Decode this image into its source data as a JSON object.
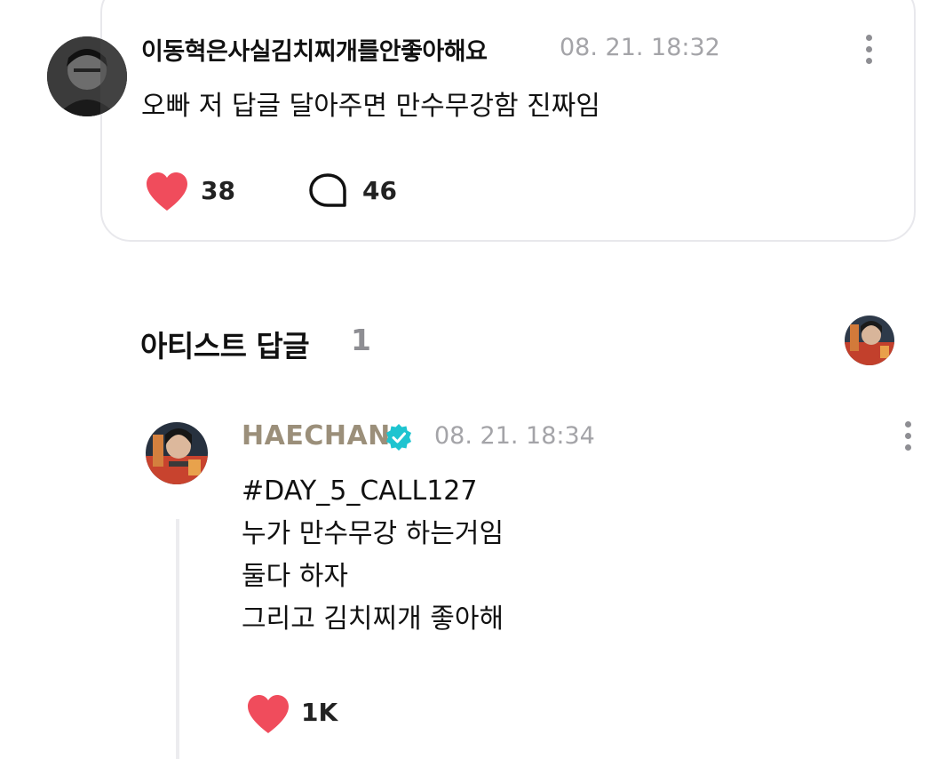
{
  "fan_comment": {
    "author": "이동혁은사실김치찌개를안좋아해요",
    "timestamp": "08. 21. 18:32",
    "text": "오빠 저 답글 달아주면 만수무강함 진짜임",
    "likes": "38",
    "replies": "46",
    "icons": {
      "more": "more-vertical-icon",
      "like": "heart-icon",
      "reply": "speech-bubble-icon"
    }
  },
  "artist_section": {
    "title": "아티스트 답글",
    "count": "1"
  },
  "artist_reply": {
    "author": "HAECHAN",
    "timestamp": "08. 21. 18:34",
    "lines": [
      "#DAY_5_CALL127",
      "누가 만수무강 하는거임",
      "둘다 하자",
      "그리고 김치찌개 좋아해"
    ],
    "likes": "1K",
    "icons": {
      "verified": "verified-badge-icon",
      "more": "more-vertical-icon",
      "like": "heart-icon"
    }
  },
  "colors": {
    "heart": "#f04c5c",
    "verified": "#1ec4d0",
    "artist_name": "#9b8f7a",
    "timestamp": "#a4a4a8",
    "card_border": "#e8e8ec"
  }
}
